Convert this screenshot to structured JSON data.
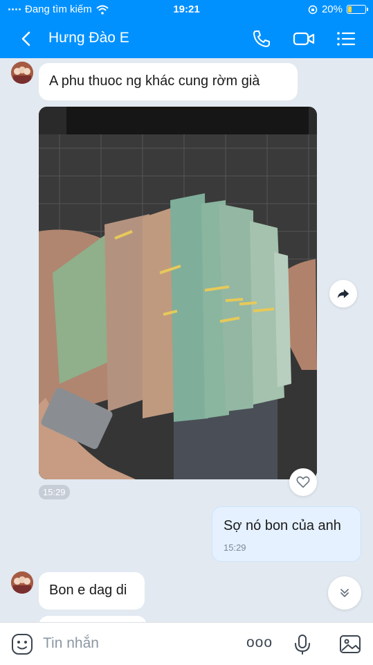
{
  "status_bar": {
    "carrier": "Đang tìm kiếm",
    "time": "19:21",
    "battery": "20%",
    "battery_level": 0.2
  },
  "header": {
    "contact_name": "Hưng Đào E",
    "icons": [
      "back-icon",
      "phone-icon",
      "video-call-icon",
      "menu-icon"
    ]
  },
  "messages": [
    {
      "direction": "in",
      "text": "A phu thuoc ng khác cung rờm già"
    },
    {
      "direction": "in",
      "type": "image",
      "time": "15:29"
    },
    {
      "direction": "out",
      "text": "Sợ nó bon của anh",
      "time": "15:29"
    },
    {
      "direction": "in",
      "text": "Bon e dag di"
    }
  ],
  "input": {
    "placeholder": "Tin nhắn",
    "more_label": "ooo",
    "icons": [
      "sticker-icon",
      "more-icon",
      "microphone-icon",
      "gallery-icon"
    ]
  },
  "colors": {
    "brand": "#0091ff",
    "chat_background": "#e2e9f1",
    "outgoing_bubble": "#e5f1ff",
    "incoming_bubble": "#ffffff"
  }
}
